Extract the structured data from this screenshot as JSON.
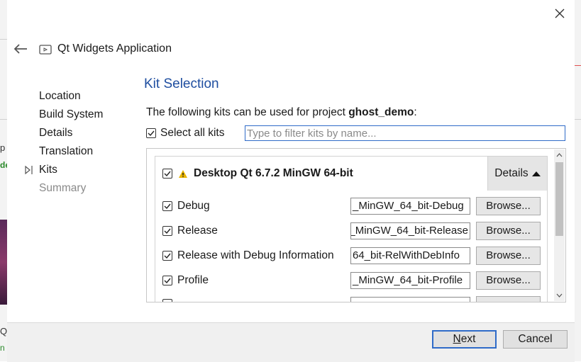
{
  "dialog": {
    "close_label": "×"
  },
  "header": {
    "title": "Qt Widgets Application"
  },
  "background": {
    "left_texts": [
      "p",
      "de",
      "Qt",
      "n"
    ]
  },
  "steps": [
    {
      "label": "Location",
      "current": false,
      "disabled": false
    },
    {
      "label": "Build System",
      "current": false,
      "disabled": false
    },
    {
      "label": "Details",
      "current": false,
      "disabled": false
    },
    {
      "label": "Translation",
      "current": false,
      "disabled": false
    },
    {
      "label": "Kits",
      "current": true,
      "disabled": false
    },
    {
      "label": "Summary",
      "current": false,
      "disabled": true
    }
  ],
  "page": {
    "title": "Kit Selection",
    "intro_prefix": "The following kits can be used for project ",
    "project_name": "ghost_demo",
    "intro_suffix": ":"
  },
  "select_all": {
    "label": "Select all kits",
    "checked": true
  },
  "filter": {
    "placeholder": "Type to filter kits by name...",
    "value": ""
  },
  "kit": {
    "name": "Desktop Qt 6.7.2 MinGW 64-bit",
    "checked": true,
    "warning": true,
    "details_label": "Details",
    "build_configs": [
      {
        "label": "Debug",
        "checked": true,
        "path": "_MinGW_64_bit-Debug",
        "browse_label": "Browse..."
      },
      {
        "label": "Release",
        "checked": true,
        "path": "_MinGW_64_bit-Release",
        "browse_label": "Browse..."
      },
      {
        "label": "Release with Debug Information",
        "checked": true,
        "path": "64_bit-RelWithDebInfo",
        "browse_label": "Browse..."
      },
      {
        "label": "Profile",
        "checked": true,
        "path": "_MinGW_64_bit-Profile",
        "browse_label": "Browse..."
      }
    ]
  },
  "footer": {
    "next_label": "Next",
    "next_mnemonic": "N",
    "next_rest": "ext",
    "cancel_label": "Cancel"
  },
  "colors": {
    "accent": "#2f6bc8",
    "title_blue": "#1f4ea0",
    "warning": "#e8b400"
  }
}
